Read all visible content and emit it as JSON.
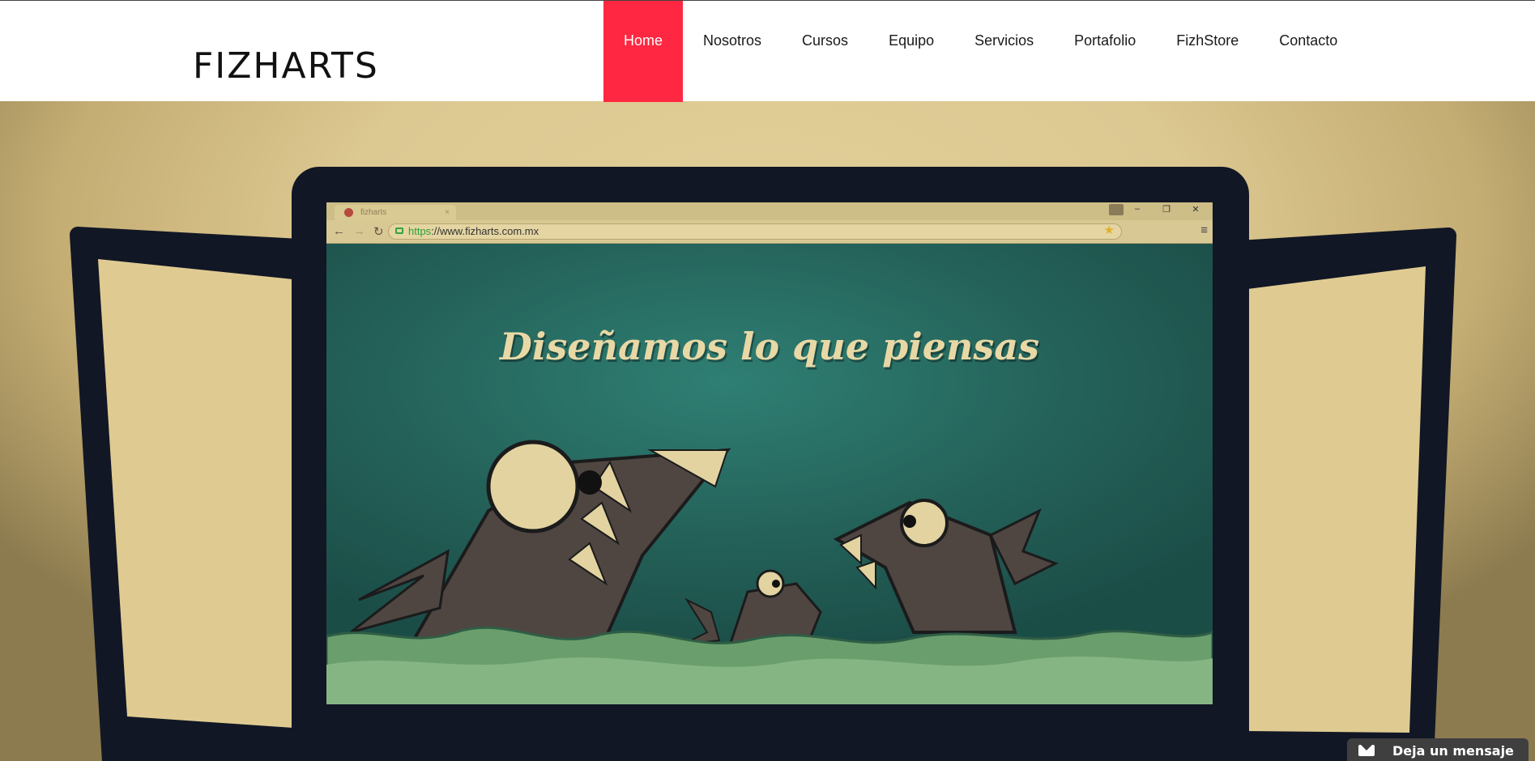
{
  "header": {
    "logo": "FIZHARTS",
    "nav": [
      {
        "label": "Home",
        "active": true
      },
      {
        "label": "Nosotros"
      },
      {
        "label": "Cursos"
      },
      {
        "label": "Equipo"
      },
      {
        "label": "Servicios"
      },
      {
        "label": "Portafolio"
      },
      {
        "label": "FizhStore"
      },
      {
        "label": "Contacto"
      }
    ],
    "accent_color": "#ff2741"
  },
  "hero": {
    "browser": {
      "tab_title": "fizharts",
      "tab_close": "×",
      "url_scheme": "https",
      "url_rest": "://www.fizharts.com.mx",
      "window_buttons": [
        "–",
        "❐",
        "✕"
      ],
      "nav_icons": [
        "back-arrow-icon",
        "forward-arrow-icon",
        "reload-icon"
      ]
    },
    "tagline": "Diseñamos lo que piensas"
  },
  "chat_widget": {
    "label": "Deja un mensaje",
    "icon": "envelope-icon"
  }
}
